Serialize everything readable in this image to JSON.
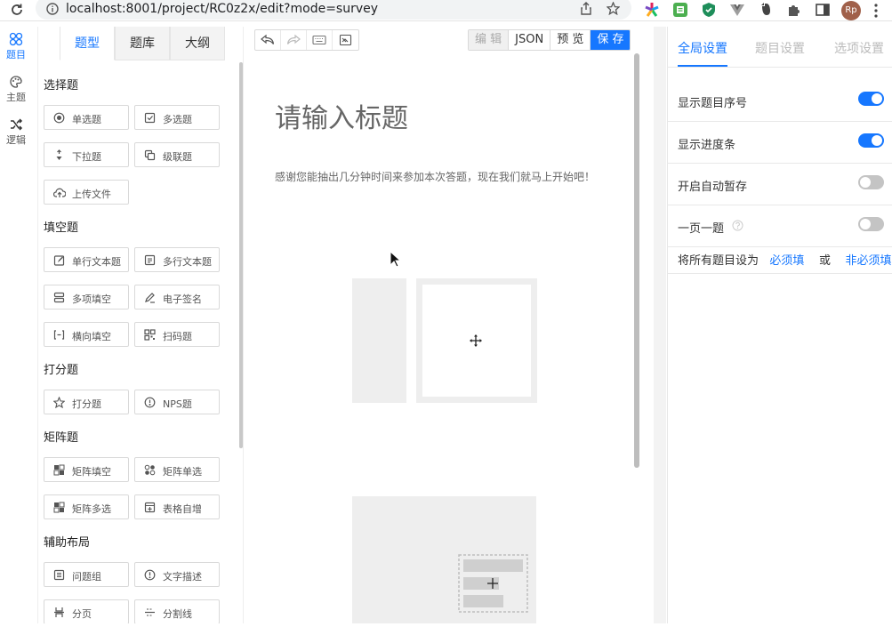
{
  "browser": {
    "url": "localhost:8001/project/RC0z2x/edit?mode=survey",
    "avatar_initials": "Rp"
  },
  "rail": {
    "items": [
      {
        "label": "题目",
        "icon": "question-icon",
        "active": true
      },
      {
        "label": "主题",
        "icon": "palette-icon",
        "active": false
      },
      {
        "label": "逻辑",
        "icon": "shuffle-icon",
        "active": false
      }
    ]
  },
  "panel": {
    "tabs": [
      "题型",
      "题库",
      "大纲"
    ],
    "groups": {
      "choice": {
        "title": "选择题",
        "items": [
          {
            "label": "单选题",
            "icon": "radio-icon"
          },
          {
            "label": "多选题",
            "icon": "checkbox-icon"
          },
          {
            "label": "下拉题",
            "icon": "dropdown-icon"
          },
          {
            "label": "级联题",
            "icon": "cascade-icon"
          },
          {
            "label": "上传文件",
            "icon": "upload-icon"
          }
        ]
      },
      "fill": {
        "title": "填空题",
        "items": [
          {
            "label": "单行文本题",
            "icon": "edit-icon"
          },
          {
            "label": "多行文本题",
            "icon": "textarea-icon"
          },
          {
            "label": "多项填空",
            "icon": "multi-fill-icon"
          },
          {
            "label": "电子签名",
            "icon": "signature-icon"
          },
          {
            "label": "横向填空",
            "icon": "inline-fill-icon"
          },
          {
            "label": "扫码题",
            "icon": "qrcode-icon"
          }
        ]
      },
      "score": {
        "title": "打分题",
        "items": [
          {
            "label": "打分题",
            "icon": "star-icon"
          },
          {
            "label": "NPS题",
            "icon": "gauge-icon"
          }
        ]
      },
      "matrix": {
        "title": "矩阵题",
        "items": [
          {
            "label": "矩阵填空",
            "icon": "matrix-fill-icon"
          },
          {
            "label": "矩阵单选",
            "icon": "matrix-radio-icon"
          },
          {
            "label": "矩阵多选",
            "icon": "matrix-checkbox-icon"
          },
          {
            "label": "表格自增",
            "icon": "table-add-icon"
          }
        ]
      },
      "layout": {
        "title": "辅助布局",
        "items": [
          {
            "label": "问题组",
            "icon": "group-icon"
          },
          {
            "label": "文字描述",
            "icon": "info-icon"
          },
          {
            "label": "分页",
            "icon": "pagebreak-icon"
          },
          {
            "label": "分割线",
            "icon": "divider-icon"
          }
        ]
      }
    }
  },
  "toolbar": {
    "edit": "编 辑",
    "json": "JSON",
    "preview": "预 览",
    "save": "保 存"
  },
  "canvas": {
    "title": "请输入标题",
    "description": "感谢您能抽出几分钟时间来参加本次答题，现在我们就马上开始吧！"
  },
  "settings": {
    "tabs": [
      "全局设置",
      "题目设置",
      "选项设置"
    ],
    "rows": [
      {
        "label": "显示题目序号",
        "on": true
      },
      {
        "label": "显示进度条",
        "on": true
      },
      {
        "label": "开启自动暂存",
        "on": false
      },
      {
        "label": "一页一题",
        "on": false
      }
    ],
    "required": {
      "prefix": "将所有题目设为",
      "required_link": "必须填",
      "or": "或",
      "optional_link": "非必须填"
    }
  },
  "colors": {
    "accent": "#1677ff",
    "switch_off": "#c4c4c4"
  }
}
